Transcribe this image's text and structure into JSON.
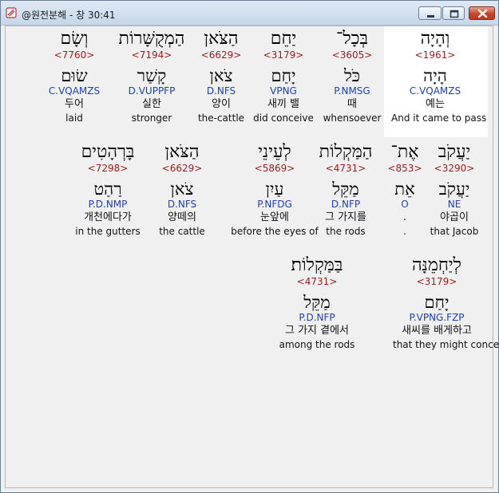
{
  "window": {
    "title": "@원전분해 - 창 30:41",
    "buttons": {
      "minimize": "minimize",
      "maximize": "maximize",
      "close": "close"
    }
  },
  "colors": {
    "strong_number": "#9b1c1c",
    "parsing": "#1f3fb8",
    "highlight_bg": "#ffffff"
  },
  "words": [
    {
      "heb": "וְהָיָה",
      "strong": "<1961>",
      "lemma": "הָיָה",
      "parse": "C.VQAMZS",
      "kor": "예는",
      "eng": "And it came to pass",
      "highlighted": true
    },
    {
      "heb": "בְּכָל־",
      "strong": "<3605>",
      "lemma": "כֹּל",
      "parse": "P.NMSG",
      "kor": "때",
      "eng": "whensoever",
      "highlighted": false
    },
    {
      "heb": "יַחֵם",
      "strong": "<3179>",
      "lemma": "יָחַם",
      "parse": "VPNG",
      "kor": "새끼 밸",
      "eng": "did conceive",
      "highlighted": false
    },
    {
      "heb": "הַצֹּאן",
      "strong": "<6629>",
      "lemma": "צֹאן",
      "parse": "D.NFS",
      "kor": "양이",
      "eng": "the-cattle",
      "highlighted": false
    },
    {
      "heb": "הַמְקֻשָּׁרוֹת",
      "strong": "<7194>",
      "lemma": "קָשַׁר",
      "parse": "D.VUPPFP",
      "kor": "실한",
      "eng": "stronger",
      "highlighted": false
    },
    {
      "heb": "וְשָׂם",
      "strong": "<7760>",
      "lemma": "שׂוּם",
      "parse": "C.VQAMZS",
      "kor": "두어",
      "eng": "laid",
      "highlighted": false
    },
    {
      "heb": "יַעֲקֹב",
      "strong": "<3290>",
      "lemma": "יַעֲקֹב",
      "parse": "NE",
      "kor": "야곱이",
      "eng": "that Jacob",
      "highlighted": false
    },
    {
      "heb": "אֶת־",
      "strong": "<853>",
      "lemma": "אֵת",
      "parse": "O",
      "kor": ".",
      "eng": ".",
      "highlighted": false
    },
    {
      "heb": "הַמַּקְלוֹת",
      "strong": "<4731>",
      "lemma": "מַקֵּל",
      "parse": "D.NFP",
      "kor": "그 가지를",
      "eng": "the rods",
      "highlighted": false
    },
    {
      "heb": "לְעֵינֵי",
      "strong": "<5869>",
      "lemma": "עַיִן",
      "parse": "P.NFDG",
      "kor": "눈앞에",
      "eng": "before the eyes of",
      "highlighted": false
    },
    {
      "heb": "הַצֹּאן",
      "strong": "<6629>",
      "lemma": "צֹאן",
      "parse": "D.NFS",
      "kor": "양떼의",
      "eng": "the cattle",
      "highlighted": false
    },
    {
      "heb": "בָּרְהָטִים",
      "strong": "<7298>",
      "lemma": "רַהַט",
      "parse": "P.D.NMP",
      "kor": "개천에다가",
      "eng": "in the gutters",
      "highlighted": false
    },
    {
      "heb": "לְיַחְמֵנָּה",
      "strong": "<3179>",
      "lemma": "יָחַם",
      "parse": "P.VPNG.FZP",
      "kor": "새씨를 배게하고",
      "eng": "that they might conceive",
      "highlighted": false
    },
    {
      "heb": "בַּמַּקְלוֹת׃",
      "strong": "<4731>",
      "lemma": "מַקֵּל",
      "parse": "P.D.NFP",
      "kor": "그 가지 곁에서",
      "eng": "among the rods",
      "highlighted": false
    }
  ]
}
